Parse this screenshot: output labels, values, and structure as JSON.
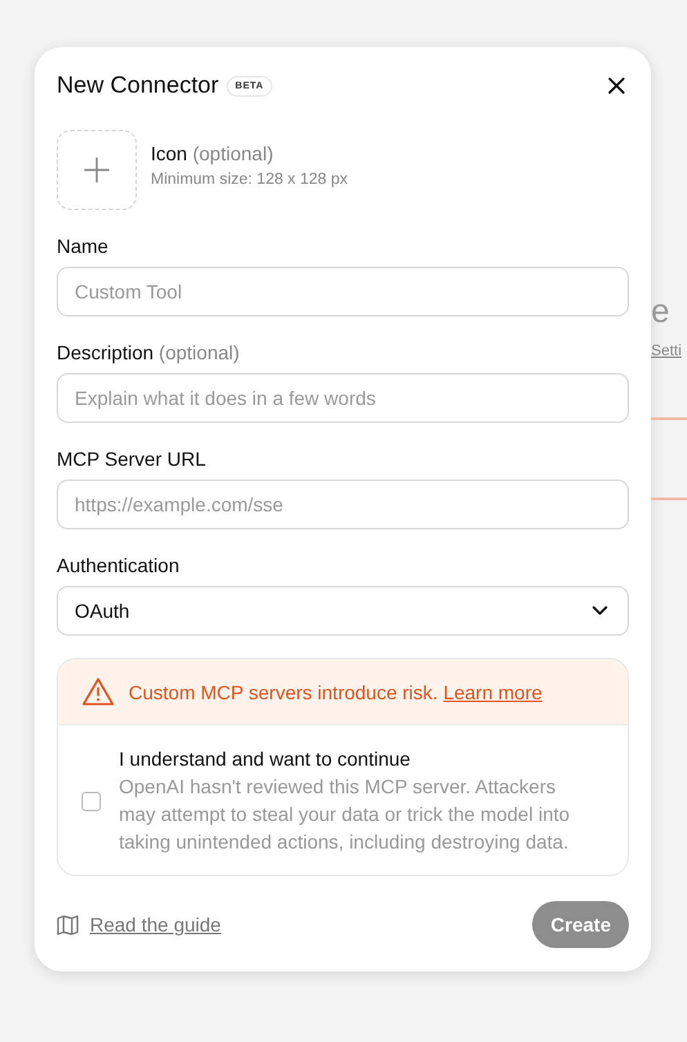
{
  "dialog": {
    "title": "New Connector",
    "badge": "BETA",
    "icon_upload": {
      "label": "Icon",
      "optional": "(optional)",
      "hint": "Minimum size: 128 x 128 px"
    },
    "fields": [
      {
        "kind": "text",
        "label": "Name",
        "placeholder": "Custom Tool"
      },
      {
        "kind": "text",
        "label": "Description",
        "optional": "(optional)",
        "placeholder": "Explain what it does in a few words"
      },
      {
        "kind": "text",
        "label": "MCP Server URL",
        "placeholder": "https://example.com/sse"
      },
      {
        "kind": "select",
        "label": "Authentication",
        "value": "OAuth"
      }
    ],
    "warning": {
      "message": "Custom MCP servers introduce risk.",
      "link": "Learn more"
    },
    "consent": {
      "checked": false,
      "title": "I understand and want to continue",
      "body": "OpenAI hasn't reviewed this MCP server. Attackers may attempt to steal your data or trick the model into taking unintended actions, including destroying data."
    },
    "guide_link": "Read the guide",
    "create_button": {
      "label": "Create",
      "disabled": true
    }
  },
  "background": {
    "heading_fragment": "e",
    "link_fragment": "Setti"
  }
}
